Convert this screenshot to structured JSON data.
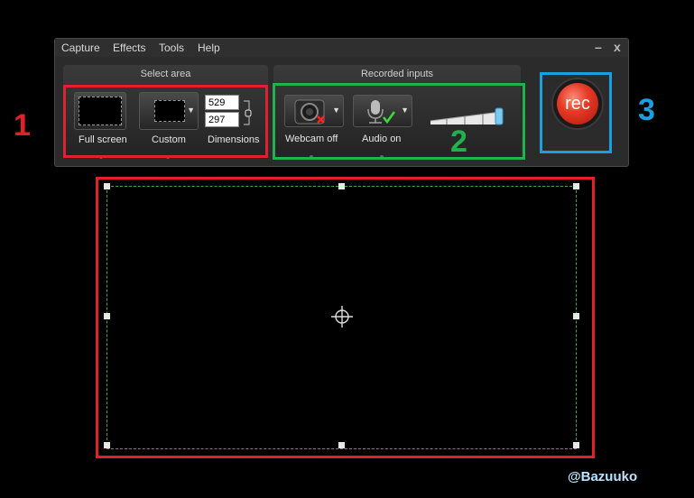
{
  "menu": [
    "Capture",
    "Effects",
    "Tools",
    "Help"
  ],
  "window_controls": {
    "minimize": "–",
    "close": "x"
  },
  "select_area": {
    "title": "Select area",
    "full_screen_label": "Full screen",
    "custom_label": "Custom",
    "dimensions_label": "Dimensions",
    "width": "529",
    "height": "297"
  },
  "recorded_inputs": {
    "title": "Recorded inputs",
    "webcam_label": "Webcam off",
    "audio_label": "Audio on"
  },
  "rec_label": "rec",
  "annotations": [
    "1",
    "2",
    "3"
  ],
  "watermark": "@Bazuuko",
  "colors": {
    "annotation_red": "#e0202a",
    "annotation_green": "#22b14c",
    "annotation_blue": "#1a9fe0",
    "frame_dash": "#3fa84a",
    "rec_red": "#e63a26"
  }
}
